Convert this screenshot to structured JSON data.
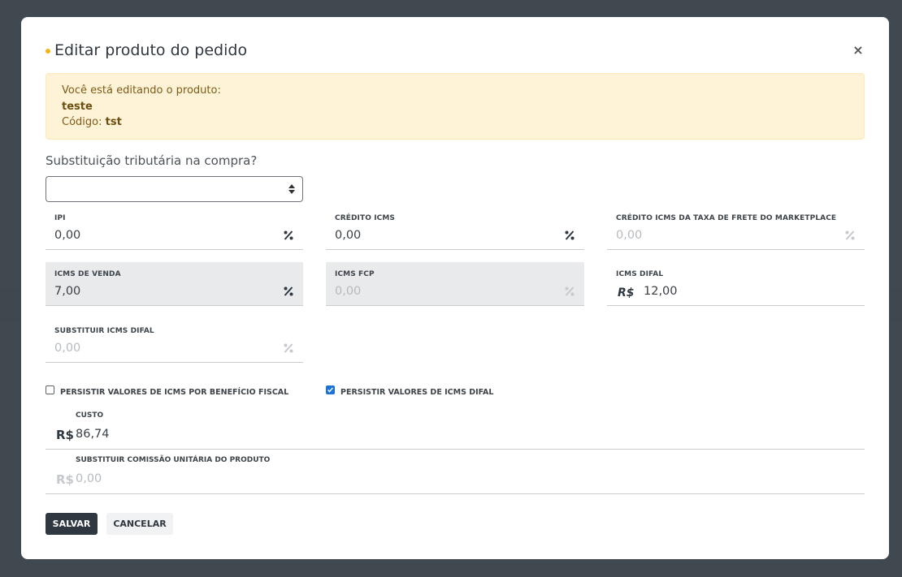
{
  "modal": {
    "title": "Editar produto do pedido",
    "close_icon": "×"
  },
  "alert": {
    "line1": "Você está editando o produto:",
    "product_name": "teste",
    "code_label": "Código: ",
    "code_value": "tst"
  },
  "st": {
    "label": "Substituição tributária na compra?",
    "selected": ""
  },
  "fields": {
    "ipi": {
      "label": "IPI",
      "value": "0,00",
      "icon": "percent-icon"
    },
    "credito_icms": {
      "label": "CRÉDITO ICMS",
      "value": "0,00",
      "icon": "percent-icon"
    },
    "credito_icms_frete": {
      "label": "CRÉDITO ICMS DA TAXA DE FRETE DO MARKETPLACE",
      "value": "0,00",
      "icon": "percent-icon"
    },
    "icms_venda": {
      "label": "ICMS DE VENDA",
      "value": "7,00",
      "icon": "percent-icon"
    },
    "icms_fcp": {
      "label": "ICMS FCP",
      "value": "0,00",
      "icon": "percent-icon"
    },
    "icms_difal": {
      "label": "ICMS DIFAL",
      "prefix": "R$",
      "value": "12,00"
    },
    "substituir_icms_difal": {
      "label": "SUBSTITUIR ICMS DIFAL",
      "value": "0,00",
      "icon": "percent-icon"
    }
  },
  "checks": {
    "beneficio": {
      "label": "PERSISTIR VALORES DE ICMS POR BENEFÍCIO FISCAL",
      "checked": false
    },
    "difal": {
      "label": "PERSISTIR VALORES DE ICMS DIFAL",
      "checked": true
    }
  },
  "custo": {
    "label": "CUSTO",
    "prefix": "R$",
    "value": "86,74"
  },
  "comissao": {
    "label": "SUBSTITUIR COMISSÃO UNITÁRIA DO PRODUTO",
    "prefix": "R$",
    "value": "0,00"
  },
  "buttons": {
    "save": "SALVAR",
    "cancel": "CANCELAR"
  },
  "colors": {
    "accent": "#f5b21f",
    "primary": "#2f3740",
    "checkbox": "#1d72d8",
    "alert_bg": "#fff3d7"
  }
}
